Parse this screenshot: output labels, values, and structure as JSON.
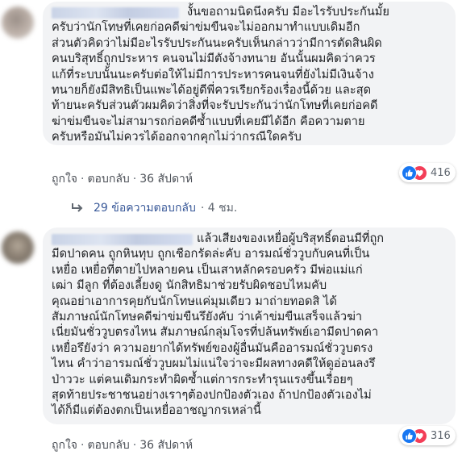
{
  "comments": [
    {
      "text": "งั้นขอถามนิดนึงครับ มีอะไรรับประกันมั้ย\nครับว่านักโทษที่เคยก่อคดีฆ่าข่มขืนจะไม่ออกมาทำแบบเดิมอีก\nส่วนตัวคิดว่าไม่มีอะไรรับประกันนะครับเห็นกล่าวว่ามีการตัดสินผิด\nคนบริสุทธิ์ถูกประหาร คนจนไม่มีตังจ้างทนาย อันนั้นผมคิดว่าควร\nแก้ที่ระบบนั้นนะครับต่อให้ไม่มีการประหารคนจนที่ยังไม่มีเงินจ้าง\nทนายก็ยังมีสิทธิเป็นแพะได้อยู่ดีพี่ควรเรียกร้องเรื่องนี้ด้วย และสุด\nท้ายนะครับส่วนตัวผมคิดว่าสิ่งที่จะรับประกันว่านักโทษที่เคยก่อคดี\nฆ่าข่มขืนจะไม่สามารถก่อคดีซ้ำแบบที่เคยมีได้อีก คือความตาย\nครับหรือมันไม่ควรได้ออกจากคุกไม่ว่ากรณีใดครับ",
      "like": "ถูกใจ",
      "reply": "ตอบกลับ",
      "time": "36 สัปดาห์",
      "reaction_count": "416"
    },
    {
      "text": "แล้วเสียงของเหยื่อผู้บริสุทธิ์ตอนมีที่ถูก\nมีดปาดคน ถูกหินทุบ ถูกเชือกรัดล่ะคับ อารมณ์ชั่ววูบกับคนที่เป็น\nเหยื่อ เหยื่อที่ตายไปหลายคน เป็นเสาหลักครอบครัว มีพ่อแม่แก่\nเฒ่า มีลูก ที่ต้องเลี้ยงดู นักสิทธิมาช่วยรับผิดชอบไหมคับ\nคุณอย่าเอาการคุยกับนักโทษแค่มุมเดียว มาถ่ายทอดสิ ได้\nสัมภาษณ์นักโทษคดีฆ่าข่มขืนรึยังคับ ว่าเค้าข่มขืนเสร็จแล้วฆ่า\nเนี่ยมันชั่ววูบตรงไหน สัมภาษณ์กลุ่มโจรที่ปล้นทรัพย์เอามีดปาดคา\nเหยื่อรึยังว่า ความอยากได้ทรัพย์ของผู้อื่นมันคืออารมณ์ชั่ววูบตรง\nไหน คำว่าอารมณ์ชั่ววูบผมไม่แน่ใจว่าจะมีผลทางคดีให้ดูอ่อนลงรึ\nป่าววะ แต่คนเดิมกระทำผิดซ้ำแต่การกระทำรุนแรงขึ้นเรื่อยๆ\nสุดท้ายประชาชนอย่างเราๆต้องปกป้องตัวเอง ถ้าปกป้องตัวเองไม่\nได้ก็มีแต่ต้องตกเป็นเหยื่ออาชญากรเหล่านี้",
      "like": "ถูกใจ",
      "reply": "ตอบกลับ",
      "time": "36 สัปดาห์",
      "reaction_count": "316"
    }
  ],
  "replies_link": {
    "label": "29 ข้อความตอบกลับ",
    "time": "· 4 ชม."
  },
  "separator": "·",
  "icons": [
    "like-icon",
    "love-icon",
    "reply-arrow-icon"
  ],
  "colors": {
    "bubble": "#f2f3f5",
    "link": "#385898",
    "like": "#1877f2",
    "love": "#f33e58"
  }
}
